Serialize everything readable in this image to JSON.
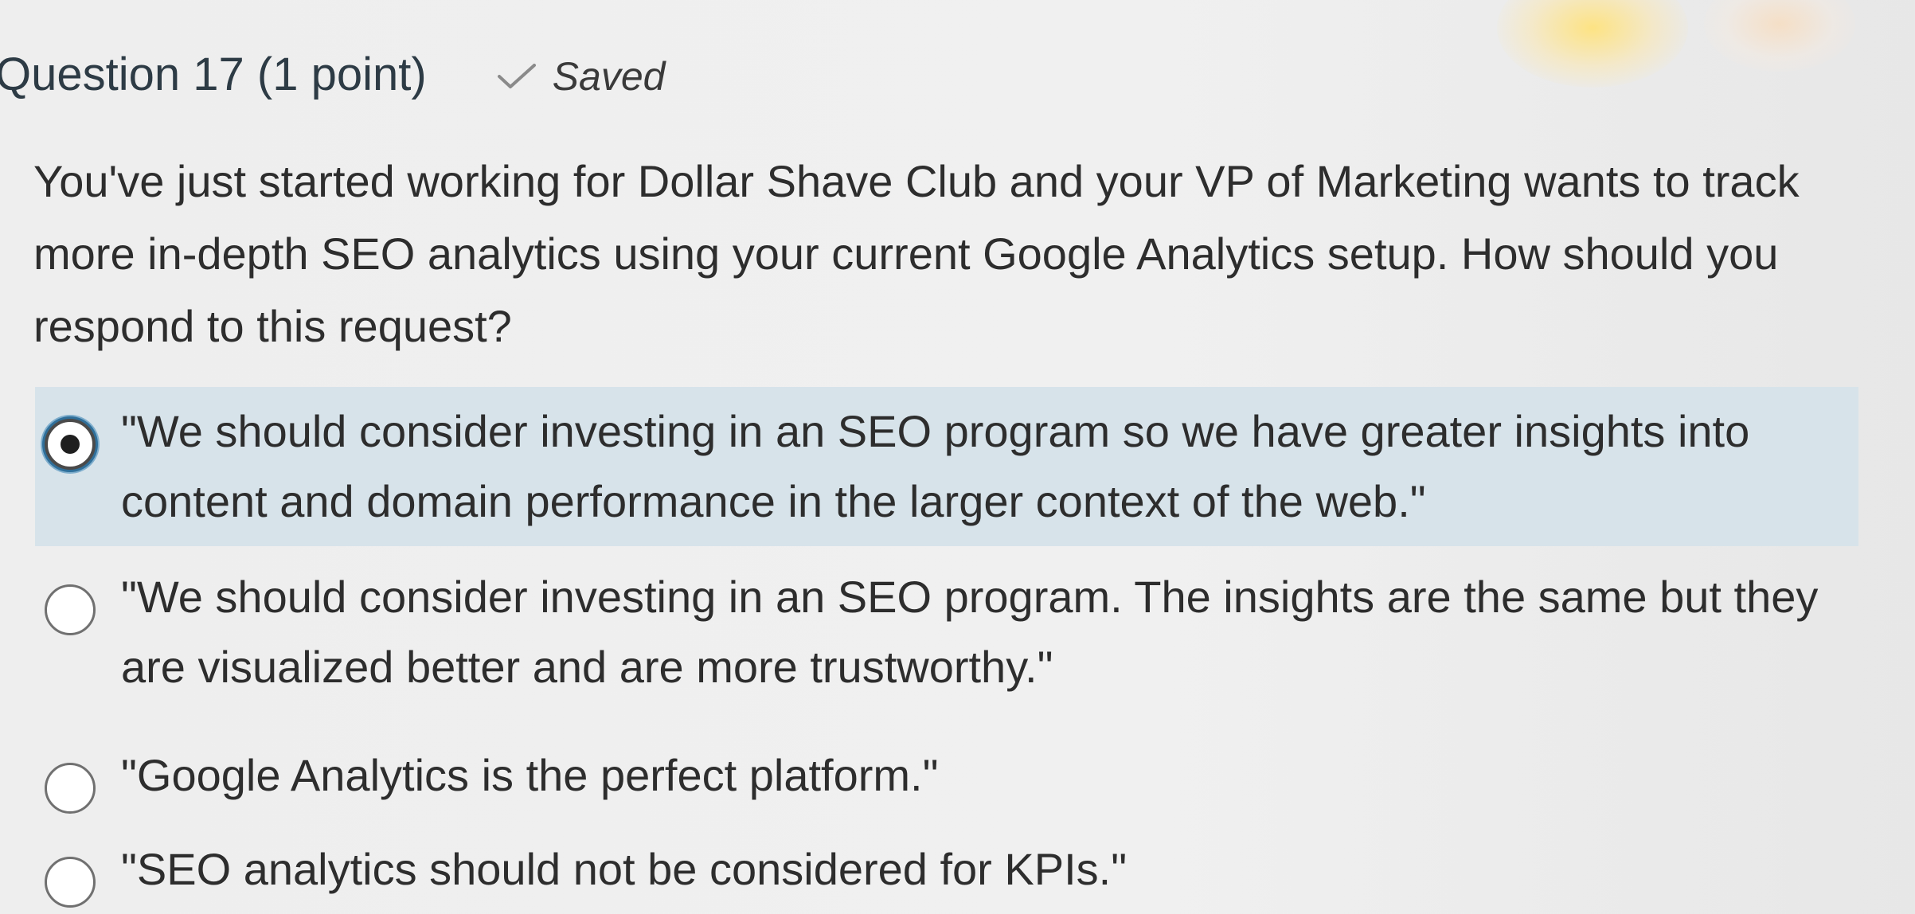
{
  "question": {
    "title": "Question 17 (1 point)",
    "saved_label": "Saved",
    "saved_icon": "check-icon",
    "text": "You've just started working for Dollar Shave Club and your VP of Marketing wants to track more in-depth SEO analytics using your current Google Analytics setup. How should you respond to this request?"
  },
  "options": [
    {
      "label": "\"We should consider investing in an SEO program so we have greater insights into content and domain performance in the larger context of the web.\"",
      "selected": true
    },
    {
      "label": "\"We should consider investing in an SEO program. The insights are the same but they are visualized better and are more trustworthy.\"",
      "selected": false
    },
    {
      "label": "\"Google Analytics is the perfect platform.\"",
      "selected": false
    },
    {
      "label": "\"SEO analytics should not be considered for KPIs.\"",
      "selected": false
    }
  ],
  "colors": {
    "selected_background": "#d7e3ea",
    "focus_ring": "#2f6f9a",
    "title_text": "#2d3b45"
  }
}
